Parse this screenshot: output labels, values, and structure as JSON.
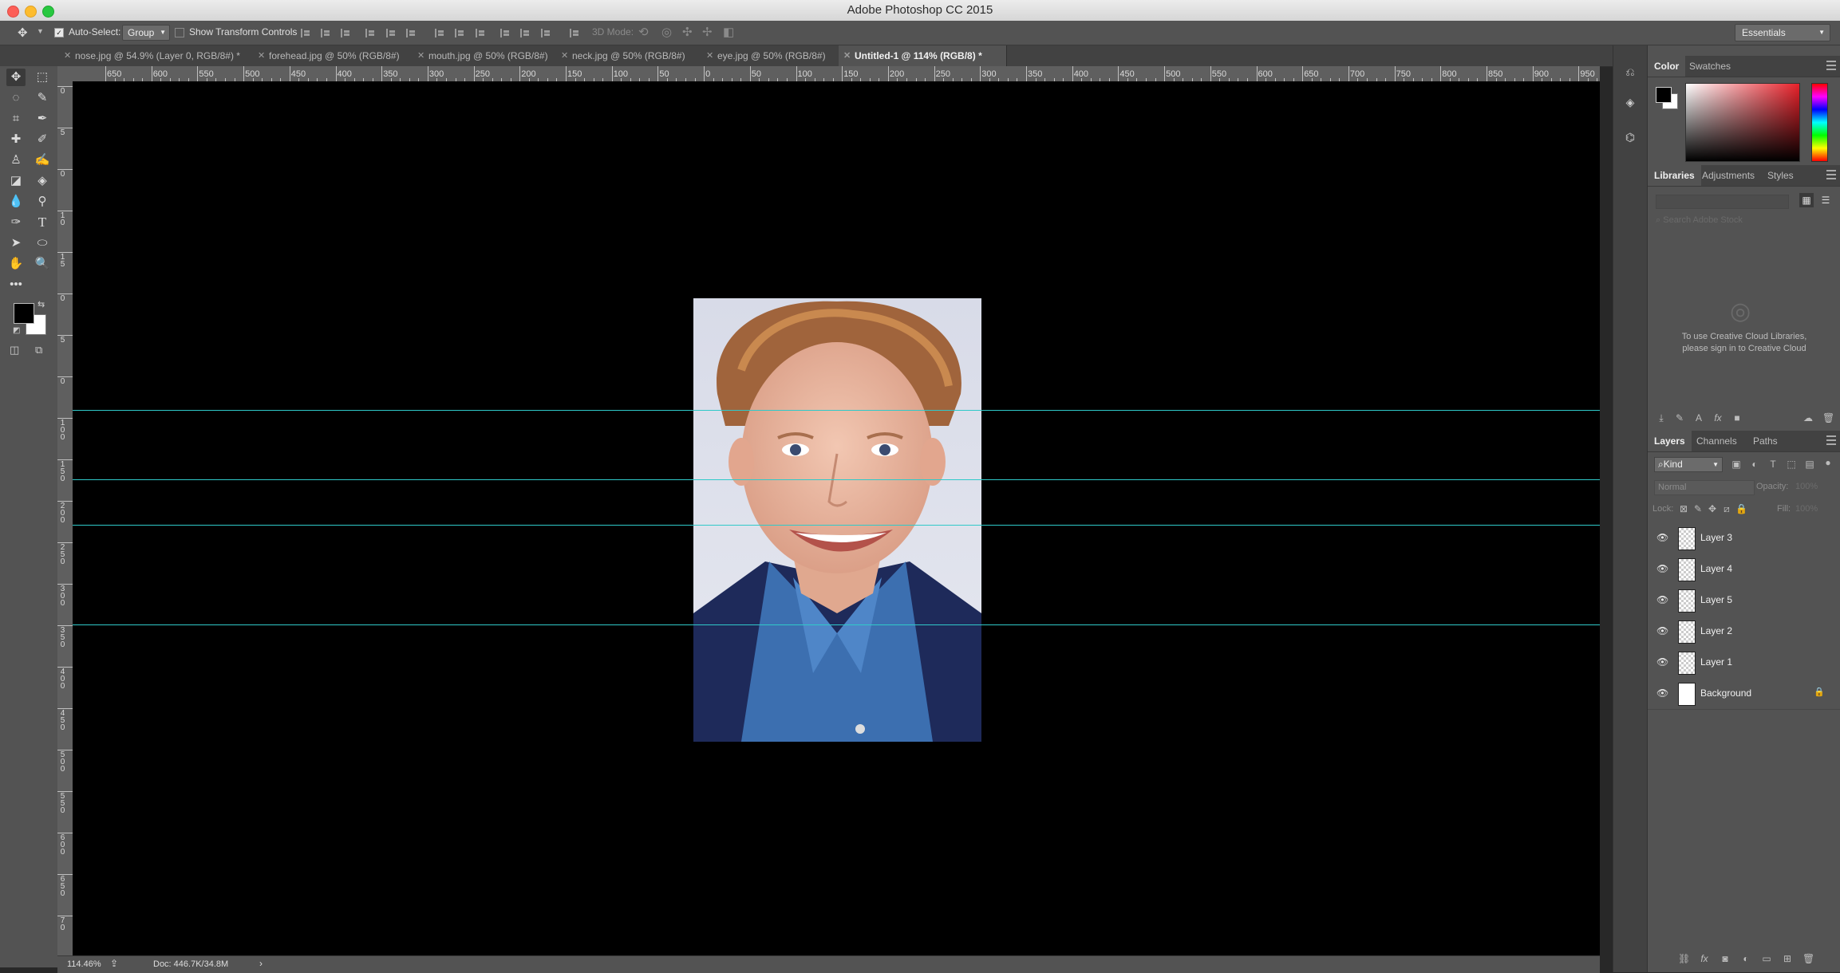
{
  "window": {
    "title": "Adobe Photoshop CC 2015"
  },
  "options_bar": {
    "auto_select_label": "Auto-Select:",
    "auto_select_checked": true,
    "auto_select_value": "Group",
    "show_transform_label": "Show Transform Controls",
    "mode_3d_label": "3D Mode:",
    "workspace": "Essentials"
  },
  "tabs": [
    {
      "label": "nose.jpg @ 54.9% (Layer 0, RGB/8#) *",
      "active": false
    },
    {
      "label": "forehead.jpg @ 50% (RGB/8#)",
      "active": false
    },
    {
      "label": "mouth.jpg @ 50% (RGB/8#)",
      "active": false
    },
    {
      "label": "neck.jpg @ 50% (RGB/8#)",
      "active": false
    },
    {
      "label": "eye.jpg @ 50% (RGB/8#)",
      "active": false
    },
    {
      "label": "Untitled-1 @ 114% (RGB/8) *",
      "active": true
    }
  ],
  "ruler": {
    "h_labels": [
      "650",
      "600",
      "550",
      "500",
      "450",
      "400",
      "350",
      "300",
      "250",
      "200",
      "150",
      "100",
      "50",
      "0",
      "50",
      "100",
      "150",
      "200",
      "250",
      "300",
      "350",
      "400",
      "450",
      "500",
      "550",
      "600",
      "650",
      "700",
      "750",
      "800",
      "850",
      "900",
      "950"
    ],
    "v_labels": [
      "0",
      "5",
      "0",
      "1 0",
      "1 5",
      "0",
      "5",
      "0",
      "1 0 0",
      "1 5 0",
      "2 0 0",
      "2 5 0",
      "3 0 0",
      "3 5 0",
      "4 0 0",
      "4 5 0",
      "5 0 0",
      "5 5 0",
      "6 0 0",
      "6 5 0",
      "7 0"
    ]
  },
  "status": {
    "zoom": "114.46%",
    "doc": "Doc: 446.7K/34.8M"
  },
  "color_panel": {
    "tabs": [
      "Color",
      "Swatches"
    ],
    "active": "Color",
    "foreground": "#000000",
    "background": "#ffffff"
  },
  "libraries_panel": {
    "tabs": [
      "Libraries",
      "Adjustments",
      "Styles"
    ],
    "active": "Libraries",
    "search_placeholder": "Search Adobe Stock",
    "message_line1": "To use Creative Cloud Libraries,",
    "message_line2": "please sign in to Creative Cloud"
  },
  "layers_panel": {
    "tabs": [
      "Layers",
      "Channels",
      "Paths"
    ],
    "active": "Layers",
    "filter_kind": "Kind",
    "blend_mode": "Normal",
    "opacity_label": "Opacity:",
    "opacity_value": "100%",
    "lock_label": "Lock:",
    "fill_label": "Fill:",
    "fill_value": "100%",
    "layers": [
      {
        "name": "Layer 3",
        "visible": true,
        "locked": false
      },
      {
        "name": "Layer 4",
        "visible": true,
        "locked": false
      },
      {
        "name": "Layer 5",
        "visible": true,
        "locked": false
      },
      {
        "name": "Layer 2",
        "visible": true,
        "locked": false
      },
      {
        "name": "Layer 1",
        "visible": true,
        "locked": false
      },
      {
        "name": "Background",
        "visible": true,
        "locked": true
      }
    ]
  },
  "canvas": {
    "background": "#000000",
    "guide_color": "#2fc9c9",
    "photo_description": "portrait"
  }
}
